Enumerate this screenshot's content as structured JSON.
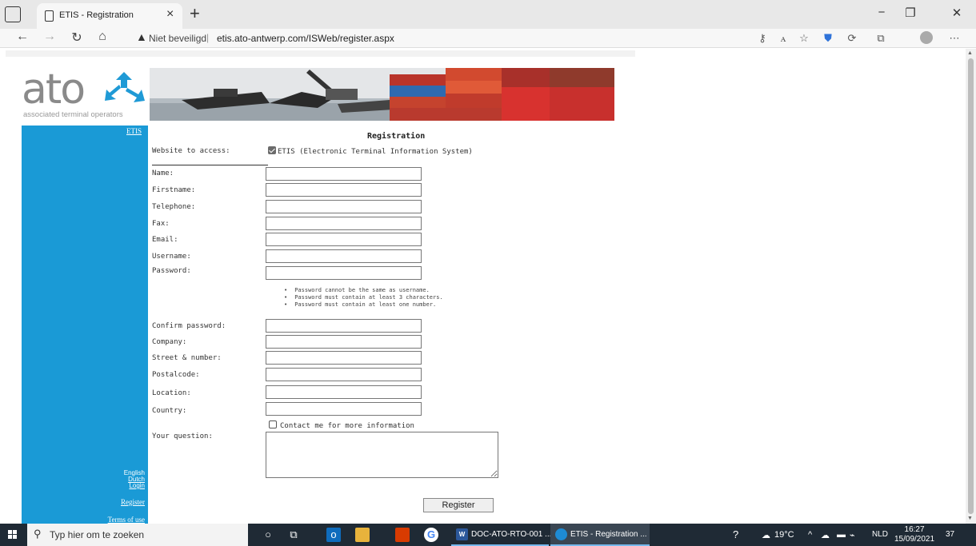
{
  "browser": {
    "tab_title": "ETIS - Registration",
    "new_tab_symbol": "+",
    "security_label": "Niet beveiligd",
    "url": "etis.ato-antwerp.com/ISWeb/register.aspx"
  },
  "logo": {
    "name": "ato",
    "tagline": "associated terminal operators"
  },
  "sidebar": {
    "top_link": "ETIS",
    "languages": [
      "English",
      "Dutch",
      "Login"
    ],
    "register_link": "Register",
    "terms_link": "Terms of use"
  },
  "form": {
    "title": "Registration",
    "website_label": "Website to access:",
    "website_option": "ETIS (Electronic Terminal Information System)",
    "website_checked": true,
    "fields": {
      "name": "Name:",
      "firstname": "Firstname:",
      "telephone": "Telephone:",
      "fax": "Fax:",
      "email": "Email:",
      "username": "Username:",
      "password": "Password:",
      "confirm": "Confirm password:",
      "company": "Company:",
      "street": "Street & number:",
      "postalcode": "Postalcode:",
      "location": "Location:",
      "country": "Country:",
      "question": "Your question:"
    },
    "password_rules": [
      "Password cannot be the same as username.",
      "Password must contain at least 3 characters.",
      "Password must contain at least one number."
    ],
    "contact_label": "Contact me for more information",
    "contact_checked": false,
    "submit_label": "Register"
  },
  "taskbar": {
    "search_placeholder": "Typ hier om te zoeken",
    "apps": [
      {
        "label": "DOC-ATO-RTO-001 ..."
      },
      {
        "label": "ETIS - Registration ..."
      }
    ],
    "temperature": "19°C",
    "language": "NLD",
    "time": "16:27",
    "date": "15/09/2021",
    "notification_count": "37"
  },
  "colors": {
    "sidebar": "#1a9ad6",
    "logo_blue": "#1f9ad6",
    "taskbar": "#1f2a35"
  }
}
